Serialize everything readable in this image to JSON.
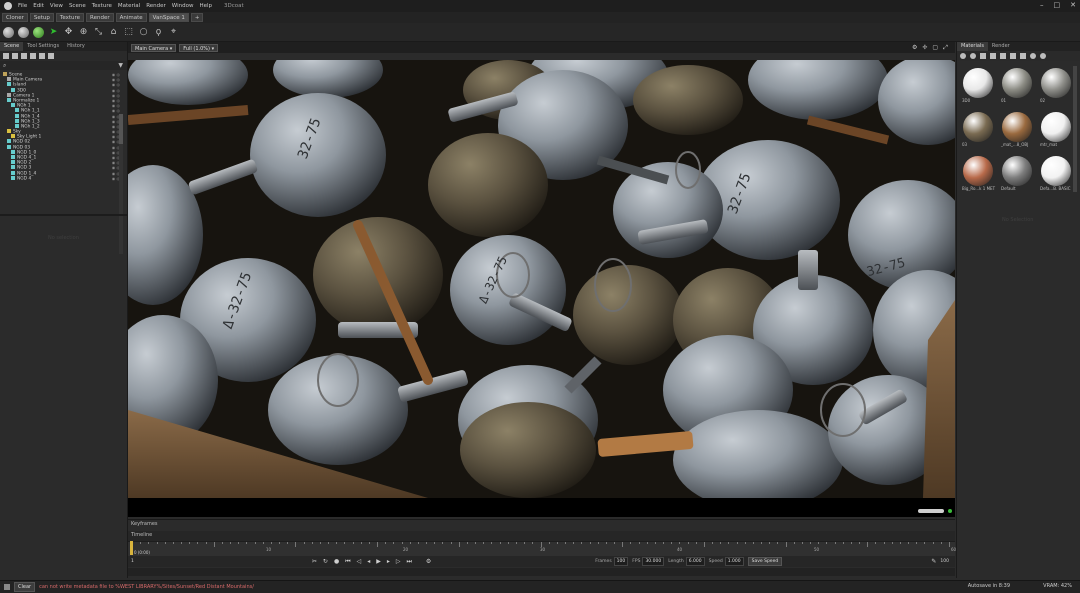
{
  "app": {
    "title": "3Dcoat",
    "menu": [
      "File",
      "Edit",
      "View",
      "Scene",
      "Texture",
      "Material",
      "Render",
      "Window",
      "Help"
    ]
  },
  "tabs": [
    {
      "label": "Cloner",
      "active": false
    },
    {
      "label": "Setup",
      "active": false
    },
    {
      "label": "Texture",
      "active": false
    },
    {
      "label": "Render",
      "active": false
    },
    {
      "label": "Animate",
      "active": false
    },
    {
      "label": "VanSpace 1",
      "active": true
    },
    {
      "label": "+",
      "active": false
    }
  ],
  "left_panel": {
    "tabs": [
      "Scene",
      "Tool Settings",
      "History"
    ],
    "scene_tree": [
      {
        "label": "Scene",
        "icon": "folder",
        "indent": 0
      },
      {
        "label": "Main Camera",
        "icon": "cam",
        "indent": 1
      },
      {
        "label": "Island",
        "icon": "mesh",
        "indent": 1
      },
      {
        "label": "3D0",
        "icon": "mesh",
        "indent": 2
      },
      {
        "label": "Camera 1",
        "icon": "cam",
        "indent": 1
      },
      {
        "label": "Normalize 1",
        "icon": "mesh",
        "indent": 1
      },
      {
        "label": "NGh 1",
        "icon": "mesh",
        "indent": 2
      },
      {
        "label": "NGh 1_1",
        "icon": "mesh",
        "indent": 3
      },
      {
        "label": "NGh 1_4",
        "icon": "mesh",
        "indent": 3
      },
      {
        "label": "NGh 1_3",
        "icon": "mesh",
        "indent": 3
      },
      {
        "label": "NGh 1_2",
        "icon": "mesh",
        "indent": 3
      },
      {
        "label": "Sky",
        "icon": "light",
        "indent": 1
      },
      {
        "label": "Sky Light 1",
        "icon": "light",
        "indent": 2
      },
      {
        "label": "NGD 02",
        "icon": "mesh",
        "indent": 1
      },
      {
        "label": "NGD 03",
        "icon": "mesh",
        "indent": 1
      },
      {
        "label": "NGD 1_0",
        "icon": "mesh",
        "indent": 2
      },
      {
        "label": "NGD 4_1",
        "icon": "mesh",
        "indent": 2
      },
      {
        "label": "NGD 2",
        "icon": "mesh",
        "indent": 2
      },
      {
        "label": "NGD 3",
        "icon": "mesh",
        "indent": 2
      },
      {
        "label": "NGD 1_4",
        "icon": "mesh",
        "indent": 2
      },
      {
        "label": "NGD 4",
        "icon": "mesh",
        "indent": 2
      }
    ],
    "lower_placeholder": "No selection"
  },
  "viewport": {
    "camera_dropdown": "Main Camera",
    "resolution_dropdown": "Full (1.0%)"
  },
  "timeline": {
    "keyframes_label": "Keyframes",
    "timeline_label": "Timeline",
    "playhead_frame": "0 (0:00)",
    "ruler_labels": [
      "10",
      "20",
      "30",
      "40",
      "50",
      "60"
    ],
    "frames_label": "Frames",
    "frames_value": "100",
    "fps_label": "FPS",
    "fps_value": "30.000",
    "length_label": "Length",
    "length_value": "6.000",
    "speed_label": "Speed",
    "speed_value": "1.000",
    "save_button": "Save Speed",
    "start_value": "1",
    "end_value": "100"
  },
  "right_panel": {
    "tabs": [
      "Materials",
      "Render"
    ],
    "materials": [
      {
        "name": "3D0",
        "color": "#e8e8e8"
      },
      {
        "name": "01",
        "color": "#8c8c84"
      },
      {
        "name": "02",
        "color": "#8f8f8a"
      },
      {
        "name": "03",
        "color": "#7a6b52"
      },
      {
        "name": "_mat_...8_OBJ",
        "color": "#9a6a3f"
      },
      {
        "name": "mtr_mat",
        "color": "#f0f0f0"
      },
      {
        "name": "Big_Ro...k 1 MET",
        "color": "#b86a4a"
      },
      {
        "name": "Default",
        "color": "#7d7d7d"
      },
      {
        "name": "Defa...B. BASIC",
        "color": "#f2f2f2"
      }
    ],
    "lower_placeholder": "No Selection"
  },
  "status": {
    "clear_button": "Clear",
    "message": "can not write metadata file to %WEST LIBRARY%/Sites/Sunset/Red Distant Mountains/",
    "autosave": "Autosave in 8:39",
    "vram": "VRAM: 42%"
  }
}
